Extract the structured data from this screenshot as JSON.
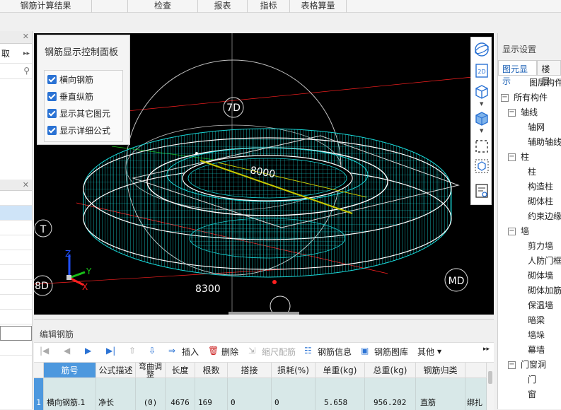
{
  "menu": {
    "items": [
      "钢筋计算结果",
      "检查",
      "报表",
      "指标",
      "表格算量"
    ]
  },
  "left_panel": {
    "row1": "取",
    "more": "▸▸"
  },
  "control_panel": {
    "title": "钢筋显示控制面板",
    "options": [
      "横向钢筋",
      "垂直纵筋",
      "显示其它图元",
      "显示详细公式"
    ]
  },
  "viewport": {
    "labels": {
      "dim_top": "7D",
      "dim_8000": "8000",
      "dim_8300": "8300",
      "axis_t": "T",
      "axis_8d": "8D",
      "axis_md": "MD",
      "axis_x": "X",
      "axis_y": "Y",
      "axis_z": "Z"
    },
    "toolbar_icons": [
      "orbit-icon",
      "2d-view-icon",
      "3d-box-icon",
      "3d-box-filled-icon",
      "select-frame-icon",
      "cube-view-icon",
      "display-settings-icon"
    ],
    "colors": {
      "rebar": "#19d9d9",
      "frame": "#dcdcdc",
      "ring": "#ffffff",
      "axis_red": "#ff2020",
      "axis_green": "#18c018",
      "axis_blue": "#2050ff"
    },
    "toolbar_label_2d": "2D"
  },
  "right_panel": {
    "title": "显示设置",
    "tabs": [
      "图元显示",
      "楼层"
    ],
    "tree": [
      {
        "label": "图层构件",
        "level": 0,
        "toggle": ""
      },
      {
        "label": "所有构件",
        "level": 0,
        "toggle": "−"
      },
      {
        "label": "轴线",
        "level": 1,
        "toggle": "−"
      },
      {
        "label": "轴网",
        "level": 2,
        "toggle": ""
      },
      {
        "label": "辅助轴线",
        "level": 2,
        "toggle": ""
      },
      {
        "label": "柱",
        "level": 1,
        "toggle": "−"
      },
      {
        "label": "柱",
        "level": 2,
        "toggle": ""
      },
      {
        "label": "构造柱",
        "level": 2,
        "toggle": ""
      },
      {
        "label": "砌体柱",
        "level": 2,
        "toggle": ""
      },
      {
        "label": "约束边缘",
        "level": 2,
        "toggle": ""
      },
      {
        "label": "墙",
        "level": 1,
        "toggle": "−"
      },
      {
        "label": "剪力墙",
        "level": 2,
        "toggle": ""
      },
      {
        "label": "人防门框",
        "level": 2,
        "toggle": ""
      },
      {
        "label": "砌体墙",
        "level": 2,
        "toggle": ""
      },
      {
        "label": "砌体加筋",
        "level": 2,
        "toggle": ""
      },
      {
        "label": "保温墙",
        "level": 2,
        "toggle": ""
      },
      {
        "label": "暗梁",
        "level": 2,
        "toggle": ""
      },
      {
        "label": "墙垛",
        "level": 2,
        "toggle": ""
      },
      {
        "label": "幕墙",
        "level": 2,
        "toggle": ""
      },
      {
        "label": "门窗洞",
        "level": 1,
        "toggle": "−"
      },
      {
        "label": "门",
        "level": 2,
        "toggle": ""
      },
      {
        "label": "窗",
        "level": 2,
        "toggle": ""
      }
    ]
  },
  "edit_panel": {
    "title": "编辑钢筋",
    "toolbar": {
      "insert": "插入",
      "delete": "删除",
      "scale": "缩尺配筋",
      "info": "钢筋信息",
      "library": "钢筋图库",
      "other": "其他"
    },
    "columns": [
      "筋号",
      "公式描述",
      "弯曲调整",
      "长度",
      "根数",
      "搭接",
      "损耗(%)",
      "单重(kg)",
      "总重(kg)",
      "钢筋归类"
    ],
    "rows": [
      {
        "no": "1",
        "values": [
          "横向钢筋.1",
          "净长",
          "(0)",
          "4676",
          "169",
          "0",
          "0",
          "5.658",
          "956.202",
          "直筋",
          "绑扎"
        ]
      }
    ]
  }
}
